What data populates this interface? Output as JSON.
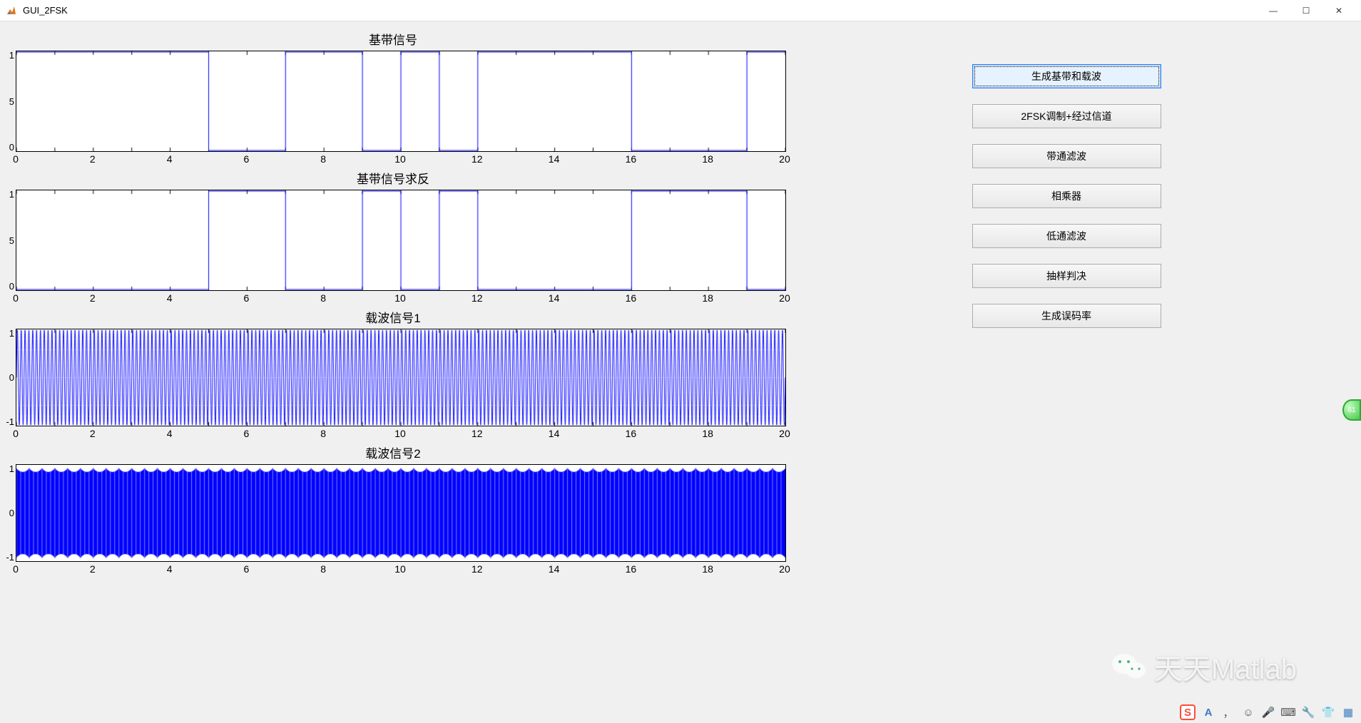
{
  "window": {
    "title": "GUI_2FSK",
    "minimize": "—",
    "maximize": "☐",
    "close": "✕"
  },
  "buttons": {
    "b1": "生成基带和载波",
    "b2": "2FSK调制+经过信道",
    "b3": "带通滤波",
    "b4": "相乘器",
    "b5": "低通滤波",
    "b6": "抽样判决",
    "b7": "生成误码率"
  },
  "watermark": {
    "text": "天天Matlab"
  },
  "badge": {
    "text": "61"
  },
  "tray": {
    "sogou": "S",
    "ime_a": "A",
    "ime_punct": "，",
    "smile": "☺",
    "mic": "🎤",
    "keyboard": "⌨",
    "tool": "🔧",
    "shirt": "👕",
    "grid": "▦"
  },
  "chart_data": [
    {
      "type": "line",
      "title": "基带信号",
      "xlabel": "",
      "ylabel": "",
      "xlim": [
        0,
        20
      ],
      "ylim": [
        0,
        1
      ],
      "xticks": [
        0,
        2,
        4,
        6,
        8,
        10,
        12,
        14,
        16,
        18,
        20
      ],
      "yticks": [
        "1",
        "5",
        "0"
      ],
      "bits": [
        1,
        1,
        1,
        1,
        1,
        0,
        0,
        1,
        1,
        0,
        1,
        0,
        1,
        1,
        1,
        1,
        0,
        0,
        0,
        1
      ],
      "note": "square wave, value = bits[floor(x)] for x in [0,20)"
    },
    {
      "type": "line",
      "title": "基带信号求反",
      "xlabel": "",
      "ylabel": "",
      "xlim": [
        0,
        20
      ],
      "ylim": [
        0,
        1
      ],
      "xticks": [
        0,
        2,
        4,
        6,
        8,
        10,
        12,
        14,
        16,
        18,
        20
      ],
      "yticks": [
        "1",
        "5",
        "0"
      ],
      "bits": [
        0,
        0,
        0,
        0,
        0,
        1,
        1,
        0,
        0,
        1,
        0,
        1,
        0,
        0,
        0,
        0,
        1,
        1,
        1,
        0
      ],
      "note": "logical NOT of chart 1 bits"
    },
    {
      "type": "line",
      "title": "载波信号1",
      "xlabel": "",
      "ylabel": "",
      "xlim": [
        0,
        20
      ],
      "ylim": [
        -1,
        1
      ],
      "xticks": [
        0,
        2,
        4,
        6,
        8,
        10,
        12,
        14,
        16,
        18,
        20
      ],
      "yticks": [
        "1",
        "0",
        "-1"
      ],
      "frequency": 10,
      "note": "sin(2*pi*10*x) — high-frequency carrier filling the axes densely"
    },
    {
      "type": "line",
      "title": "载波信号2",
      "xlabel": "",
      "ylabel": "",
      "xlim": [
        0,
        20
      ],
      "ylim": [
        -1,
        1
      ],
      "xticks": [
        0,
        2,
        4,
        6,
        8,
        10,
        12,
        14,
        16,
        18,
        20
      ],
      "yticks": [
        "1",
        "0",
        "-1"
      ],
      "frequency": 30,
      "note": "sin(2*pi*30*x) — very-high-frequency carrier rendered as solid blue fill with scalloped edges"
    }
  ]
}
